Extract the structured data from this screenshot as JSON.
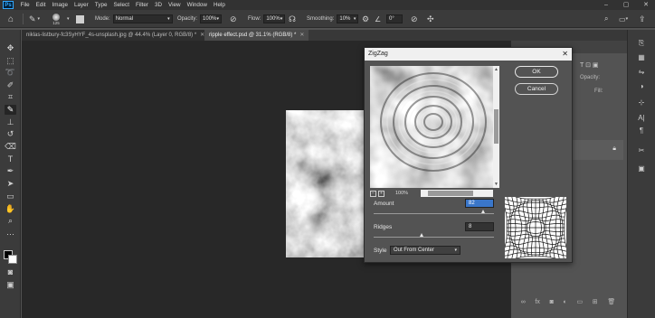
{
  "menubar": {
    "items": [
      "File",
      "Edit",
      "Image",
      "Layer",
      "Type",
      "Select",
      "Filter",
      "3D",
      "View",
      "Window",
      "Help"
    ],
    "app_logo": "Ps"
  },
  "options": {
    "brush_size": "125",
    "mode_label": "Mode:",
    "mode_value": "Normal",
    "opacity_label": "Opacity:",
    "opacity_value": "100%",
    "flow_label": "Flow:",
    "flow_value": "100%",
    "smoothing_label": "Smoothing:",
    "smoothing_value": "10%",
    "angle_value": "0°"
  },
  "tabs": [
    {
      "label": "niklas-listbury-fc3SyHYF_4s-unsplash.jpg @ 44.4% (Layer 0, RGB/8) *",
      "active": false
    },
    {
      "label": "ripple effect.psd @ 31.1% (RGB/8) *",
      "active": true
    }
  ],
  "tools": [
    "move-tool-icon",
    "marquee-tool-icon",
    "lasso-tool-icon",
    "quick-select-tool-icon",
    "crop-tool-icon",
    "eyedropper-tool-icon",
    "healing-brush-icon",
    "brush-tool-icon",
    "clone-stamp-icon",
    "history-brush-icon",
    "eraser-tool-icon",
    "gradient-tool-icon",
    "dodge-tool-icon",
    "pen-tool-icon",
    "type-tool-icon",
    "path-selection-icon",
    "rectangle-tool-icon",
    "hand-tool-icon",
    "zoom-tool-icon",
    "more-tools-icon"
  ],
  "right_panel": {
    "opacity_label": "Opacity:",
    "fill_label": "Fill:"
  },
  "dialog": {
    "title": "ZigZag",
    "close": "✕",
    "ok_label": "OK",
    "cancel_label": "Cancel",
    "zoom_value": "100%",
    "amount_label": "Amount",
    "amount_value": "82",
    "amount_fraction": 0.91,
    "ridges_label": "Ridges",
    "ridges_value": "8",
    "ridges_fraction": 0.4,
    "style_label": "Style",
    "style_value": "Out From Center"
  },
  "colors": {
    "menubar_bg": "#323232",
    "panel_bg": "#535353",
    "canvas_bg": "#282828",
    "selected_field": "#3a76c9"
  }
}
